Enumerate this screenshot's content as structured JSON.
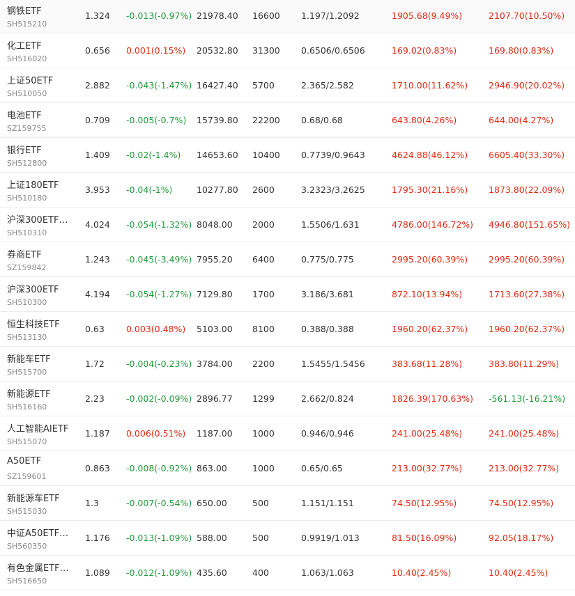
{
  "theme": {
    "up_color": "#e62a12",
    "down_color": "#1f9b3a"
  },
  "holdings": [
    {
      "name": "钢铁ETF",
      "code": "SH515210",
      "price": "1.324",
      "change": "-0.013(-0.97%)",
      "market_value": "21978.40",
      "quantity": "16600",
      "cost": "1.197/1.2092",
      "pnl_1": "1905.68(9.49%)",
      "pnl_2": "2107.70(10.50%)"
    },
    {
      "name": "化工ETF",
      "code": "SH516020",
      "price": "0.656",
      "change": "0.001(0.15%)",
      "market_value": "20532.80",
      "quantity": "31300",
      "cost": "0.6506/0.6506",
      "pnl_1": "169.02(0.83%)",
      "pnl_2": "169.80(0.83%)"
    },
    {
      "name": "上证50ETF",
      "code": "SH510050",
      "price": "2.882",
      "change": "-0.043(-1.47%)",
      "market_value": "16427.40",
      "quantity": "5700",
      "cost": "2.365/2.582",
      "pnl_1": "1710.00(11.62%)",
      "pnl_2": "2946.90(20.02%)"
    },
    {
      "name": "电池ETF",
      "code": "SZ159755",
      "price": "0.709",
      "change": "-0.005(-0.7%)",
      "market_value": "15739.80",
      "quantity": "22200",
      "cost": "0.68/0.68",
      "pnl_1": "643.80(4.26%)",
      "pnl_2": "644.00(4.27%)"
    },
    {
      "name": "银行ETF",
      "code": "SH512800",
      "price": "1.409",
      "change": "-0.02(-1.4%)",
      "market_value": "14653.60",
      "quantity": "10400",
      "cost": "0.7739/0.9643",
      "pnl_1": "4624.88(46.12%)",
      "pnl_2": "6605.40(33.30%)"
    },
    {
      "name": "上证180ETF",
      "code": "SH510180",
      "price": "3.953",
      "change": "-0.04(-1%)",
      "market_value": "10277.80",
      "quantity": "2600",
      "cost": "3.2323/3.2625",
      "pnl_1": "1795.30(21.16%)",
      "pnl_2": "1873.80(22.09%)"
    },
    {
      "name": "沪深300ETF…",
      "code": "SH510310",
      "price": "4.024",
      "change": "-0.054(-1.32%)",
      "market_value": "8048.00",
      "quantity": "2000",
      "cost": "1.5506/1.631",
      "pnl_1": "4786.00(146.72%)",
      "pnl_2": "4946.80(151.65%)"
    },
    {
      "name": "券商ETF",
      "code": "SZ159842",
      "price": "1.243",
      "change": "-0.045(-3.49%)",
      "market_value": "7955.20",
      "quantity": "6400",
      "cost": "0.775/0.775",
      "pnl_1": "2995.20(60.39%)",
      "pnl_2": "2995.20(60.39%)"
    },
    {
      "name": "沪深300ETF",
      "code": "SH510300",
      "price": "4.194",
      "change": "-0.054(-1.27%)",
      "market_value": "7129.80",
      "quantity": "1700",
      "cost": "3.186/3.681",
      "pnl_1": "872.10(13.94%)",
      "pnl_2": "1713.60(27.38%)"
    },
    {
      "name": "恒生科技ETF",
      "code": "SH513130",
      "price": "0.63",
      "change": "0.003(0.48%)",
      "market_value": "5103.00",
      "quantity": "8100",
      "cost": "0.388/0.388",
      "pnl_1": "1960.20(62.37%)",
      "pnl_2": "1960.20(62.37%)"
    },
    {
      "name": "新能车ETF",
      "code": "SH515700",
      "price": "1.72",
      "change": "-0.004(-0.23%)",
      "market_value": "3784.00",
      "quantity": "2200",
      "cost": "1.5455/1.5456",
      "pnl_1": "383.68(11.28%)",
      "pnl_2": "383.80(11.29%)"
    },
    {
      "name": "新能源ETF",
      "code": "SH516160",
      "price": "2.23",
      "change": "-0.002(-0.09%)",
      "market_value": "2896.77",
      "quantity": "1299",
      "cost": "2.662/0.824",
      "pnl_1": "1826.39(170.63%)",
      "pnl_2": "-561.13(-16.21%)"
    },
    {
      "name": "人工智能AIETF",
      "code": "SH515070",
      "price": "1.187",
      "change": "0.006(0.51%)",
      "market_value": "1187.00",
      "quantity": "1000",
      "cost": "0.946/0.946",
      "pnl_1": "241.00(25.48%)",
      "pnl_2": "241.00(25.48%)"
    },
    {
      "name": "A50ETF",
      "code": "SZ159601",
      "price": "0.863",
      "change": "-0.008(-0.92%)",
      "market_value": "863.00",
      "quantity": "1000",
      "cost": "0.65/0.65",
      "pnl_1": "213.00(32.77%)",
      "pnl_2": "213.00(32.77%)"
    },
    {
      "name": "新能源车ETF",
      "code": "SH515030",
      "price": "1.3",
      "change": "-0.007(-0.54%)",
      "market_value": "650.00",
      "quantity": "500",
      "cost": "1.151/1.151",
      "pnl_1": "74.50(12.95%)",
      "pnl_2": "74.50(12.95%)"
    },
    {
      "name": "中证A50ETF…",
      "code": "SH560350",
      "price": "1.176",
      "change": "-0.013(-1.09%)",
      "market_value": "588.00",
      "quantity": "500",
      "cost": "0.9919/1.013",
      "pnl_1": "81.50(16.09%)",
      "pnl_2": "92.05(18.17%)"
    },
    {
      "name": "有色金属ETF…",
      "code": "SH516650",
      "price": "1.089",
      "change": "-0.012(-1.09%)",
      "market_value": "435.60",
      "quantity": "400",
      "cost": "1.063/1.063",
      "pnl_1": "10.40(2.45%)",
      "pnl_2": "10.40(2.45%)"
    }
  ]
}
